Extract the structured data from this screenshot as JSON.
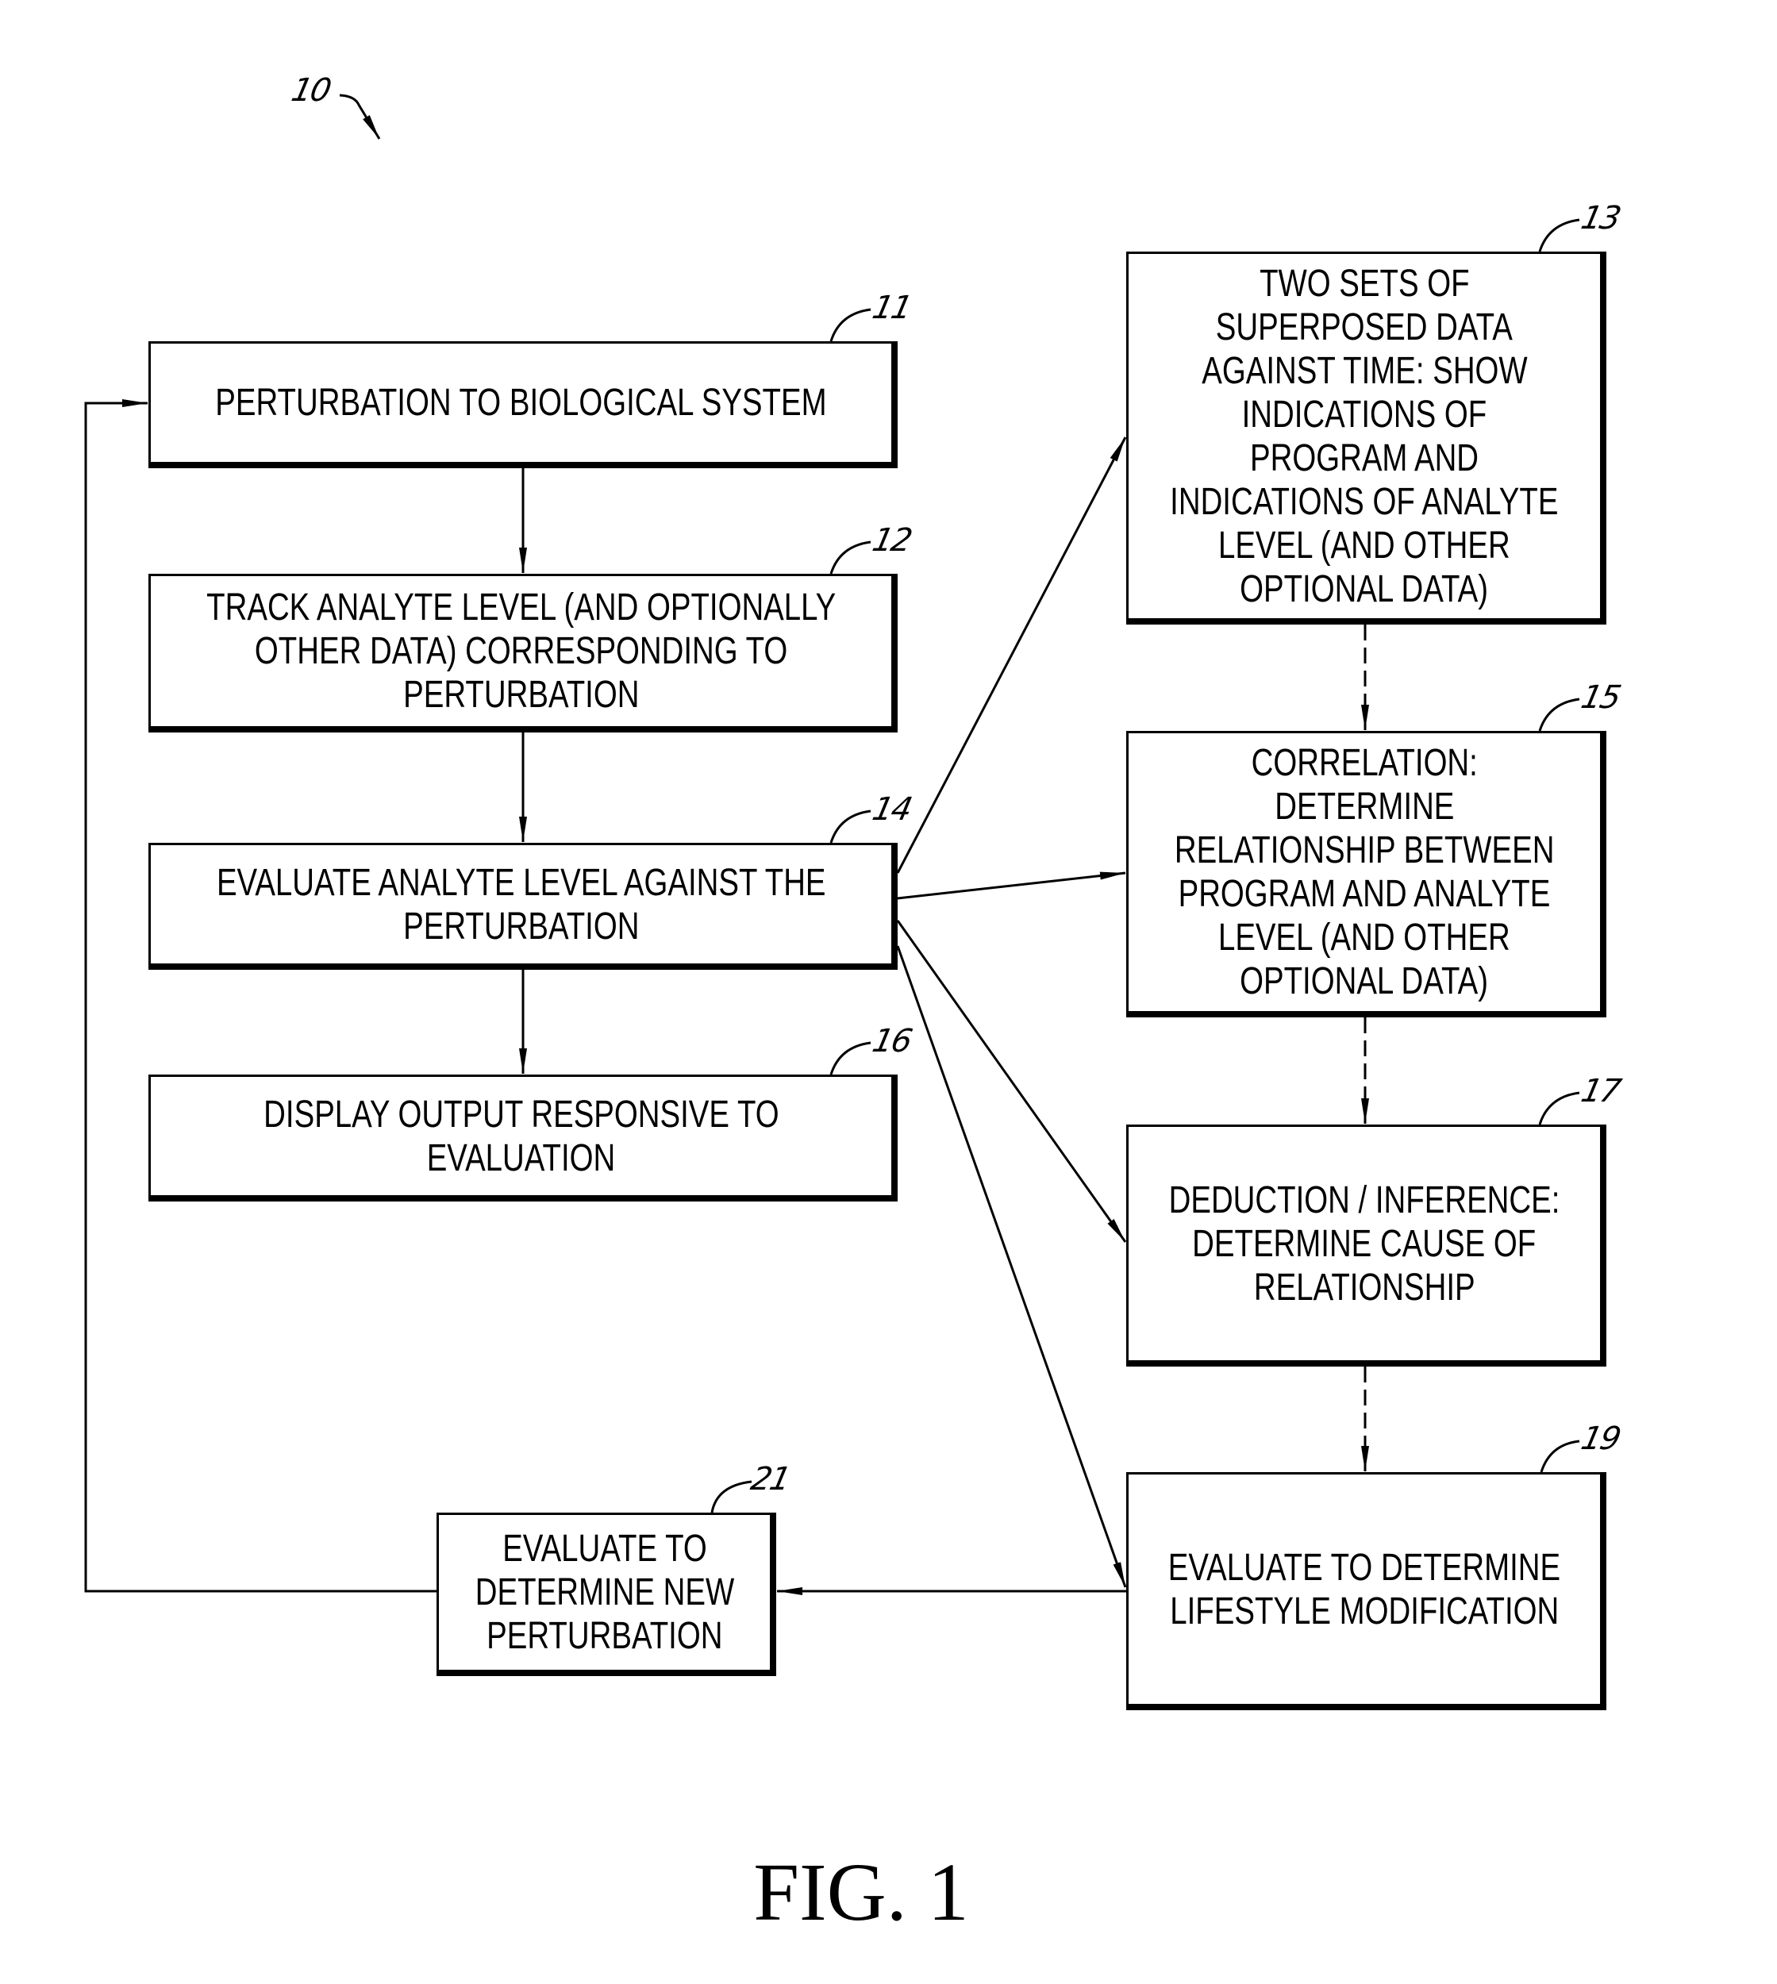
{
  "figure": {
    "caption": "FIG. 1",
    "reference_numeral": "10"
  },
  "boxes": {
    "b11": {
      "ref": "11",
      "lines": [
        "PERTURBATION TO BIOLOGICAL SYSTEM"
      ]
    },
    "b12": {
      "ref": "12",
      "lines": [
        "TRACK ANALYTE LEVEL (AND OPTIONALLY",
        "OTHER DATA) CORRESPONDING TO",
        "PERTURBATION"
      ]
    },
    "b14": {
      "ref": "14",
      "lines": [
        "EVALUATE ANALYTE LEVEL AGAINST THE",
        "PERTURBATION"
      ]
    },
    "b16": {
      "ref": "16",
      "lines": [
        "DISPLAY OUTPUT RESPONSIVE TO",
        "EVALUATION"
      ]
    },
    "b13": {
      "ref": "13",
      "lines": [
        "TWO SETS OF",
        "SUPERPOSED DATA",
        "AGAINST TIME: SHOW",
        "INDICATIONS OF",
        "PROGRAM AND",
        "INDICATIONS OF ANALYTE",
        "LEVEL (AND OTHER",
        "OPTIONAL DATA)"
      ]
    },
    "b15": {
      "ref": "15",
      "lines": [
        "CORRELATION:",
        "DETERMINE",
        "RELATIONSHIP BETWEEN",
        "PROGRAM AND ANALYTE",
        "LEVEL (AND OTHER",
        "OPTIONAL DATA)"
      ]
    },
    "b17": {
      "ref": "17",
      "lines": [
        "DEDUCTION / INFERENCE:",
        "DETERMINE CAUSE OF",
        "RELATIONSHIP"
      ]
    },
    "b19": {
      "ref": "19",
      "lines": [
        "EVALUATE TO DETERMINE",
        "LIFESTYLE MODIFICATION"
      ]
    },
    "b21": {
      "ref": "21",
      "lines": [
        "EVALUATE TO",
        "DETERMINE NEW",
        "PERTURBATION"
      ]
    }
  },
  "connections": [
    {
      "from": "b11",
      "to": "b12",
      "style": "solid"
    },
    {
      "from": "b12",
      "to": "b14",
      "style": "solid"
    },
    {
      "from": "b14",
      "to": "b16",
      "style": "solid"
    },
    {
      "from": "b14",
      "to": "b13",
      "style": "solid"
    },
    {
      "from": "b14",
      "to": "b15",
      "style": "solid"
    },
    {
      "from": "b14",
      "to": "b17",
      "style": "solid"
    },
    {
      "from": "b14",
      "to": "b19",
      "style": "solid"
    },
    {
      "from": "b13",
      "to": "b15",
      "style": "dashed"
    },
    {
      "from": "b15",
      "to": "b17",
      "style": "dashed"
    },
    {
      "from": "b17",
      "to": "b19",
      "style": "dashed"
    },
    {
      "from": "b19",
      "to": "b21",
      "style": "solid"
    },
    {
      "from": "b21",
      "to": "b11",
      "style": "solid",
      "route": "feedback-loop-left"
    }
  ]
}
